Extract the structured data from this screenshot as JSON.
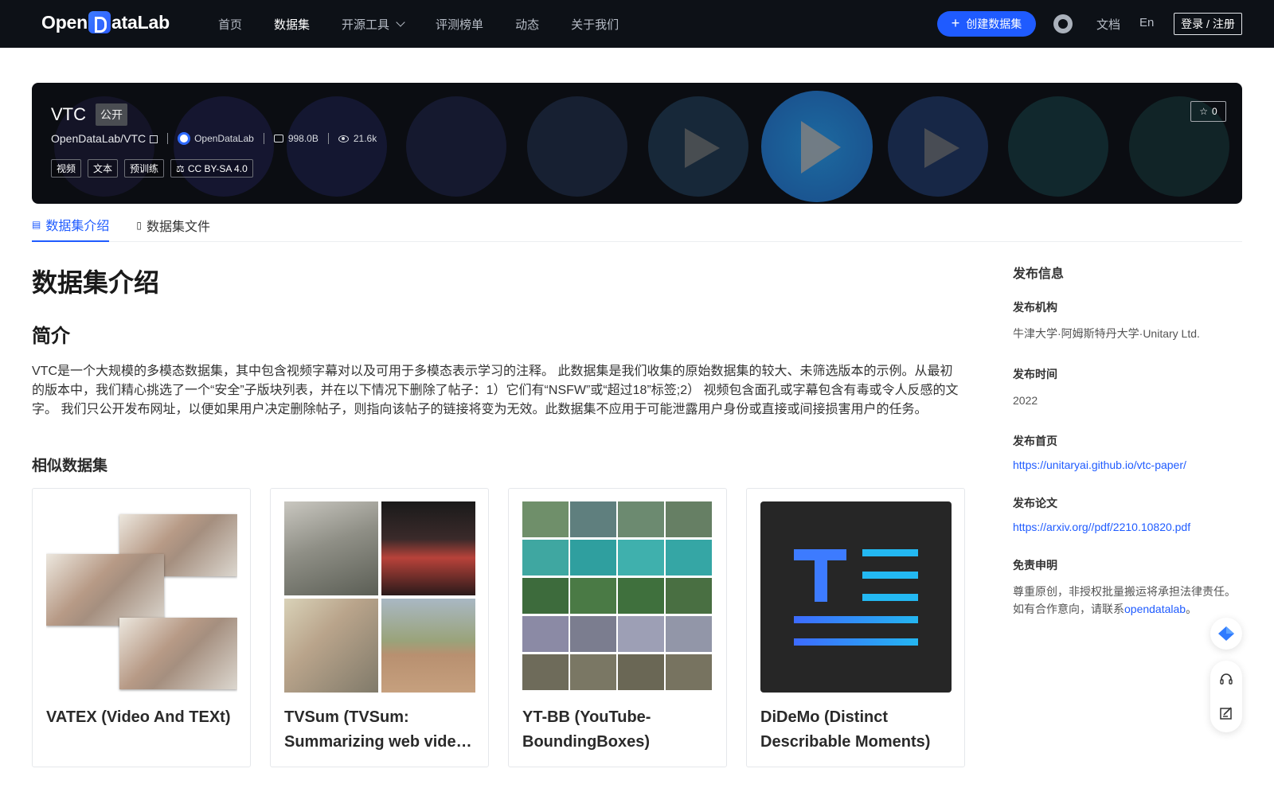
{
  "nav": {
    "logo": "OpenDataLab",
    "logo_left": "Open",
    "logo_right": "ataLab",
    "items": [
      "首页",
      "数据集",
      "开源工具",
      "评测榜单",
      "动态",
      "关于我们"
    ],
    "create_label": "创建数据集",
    "docs": "文档",
    "lang": "En",
    "login": "登录 / 注册"
  },
  "banner": {
    "title": "VTC",
    "visibility": "公开",
    "repo": "OpenDataLab/VTC",
    "org": "OpenDataLab",
    "size": "998.0B",
    "views": "21.6k",
    "tags": [
      "视频",
      "文本",
      "预训练"
    ],
    "license": "CC BY-SA 4.0",
    "stars": "0"
  },
  "tabs": [
    "数据集介绍",
    "数据集文件"
  ],
  "main": {
    "heading": "数据集介绍",
    "subheading": "简介",
    "description": "VTC是一个大规模的多模态数据集，其中包含视频字幕对以及可用于多模态表示学习的注释。 此数据集是我们收集的原始数据集的较大、未筛选版本的示例。从最初的版本中，我们精心挑选了一个“安全”子版块列表，并在以下情况下删除了帖子：1）它们有“NSFW”或“超过18”标签;2） 视频包含面孔或字幕包含有毒或令人反感的文字。 我们只公开发布网址，以便如果用户决定删除帖子，则指向该帖子的链接将变为无效。此数据集不应用于可能泄露用户身份或直接或间接损害用户的任务。",
    "similar_heading": "相似数据集",
    "cards": [
      {
        "title": "VATEX (Video And TEXt)"
      },
      {
        "title": "TVSum (TVSum: Summarizing web videos using titles)"
      },
      {
        "title": "YT-BB (YouTube-BoundingBoxes)"
      },
      {
        "title": "DiDeMo (Distinct Describable Moments)"
      }
    ]
  },
  "sidebar": {
    "title": "发布信息",
    "org_label": "发布机构",
    "org_value": "牛津大学·阿姆斯特丹大学·Unitary Ltd.",
    "time_label": "发布时间",
    "time_value": "2022",
    "home_label": "发布首页",
    "home_value": "https://unitaryai.github.io/vtc-paper/",
    "paper_label": "发布论文",
    "paper_value": "https://arxiv.org//pdf/2210.10820.pdf",
    "disclaimer_label": "免责申明",
    "disclaimer_text": "尊重原创，非授权批量搬运将承担法律责任。如有合作意向，请联系",
    "disclaimer_link": "opendatalab",
    "disclaimer_end": "。"
  },
  "colors": {
    "accent": "#1f5bff",
    "topbar": "#0d1117",
    "banner": "#0b0d12"
  },
  "icons": [
    "plus-icon",
    "github-icon",
    "copy-icon",
    "org-icon",
    "disk-icon",
    "eye-icon",
    "license-icon",
    "star-icon",
    "database-icon",
    "file-icon",
    "chevron-down-icon",
    "play-icon",
    "headset-icon",
    "edit-icon",
    "diamond-icon"
  ]
}
